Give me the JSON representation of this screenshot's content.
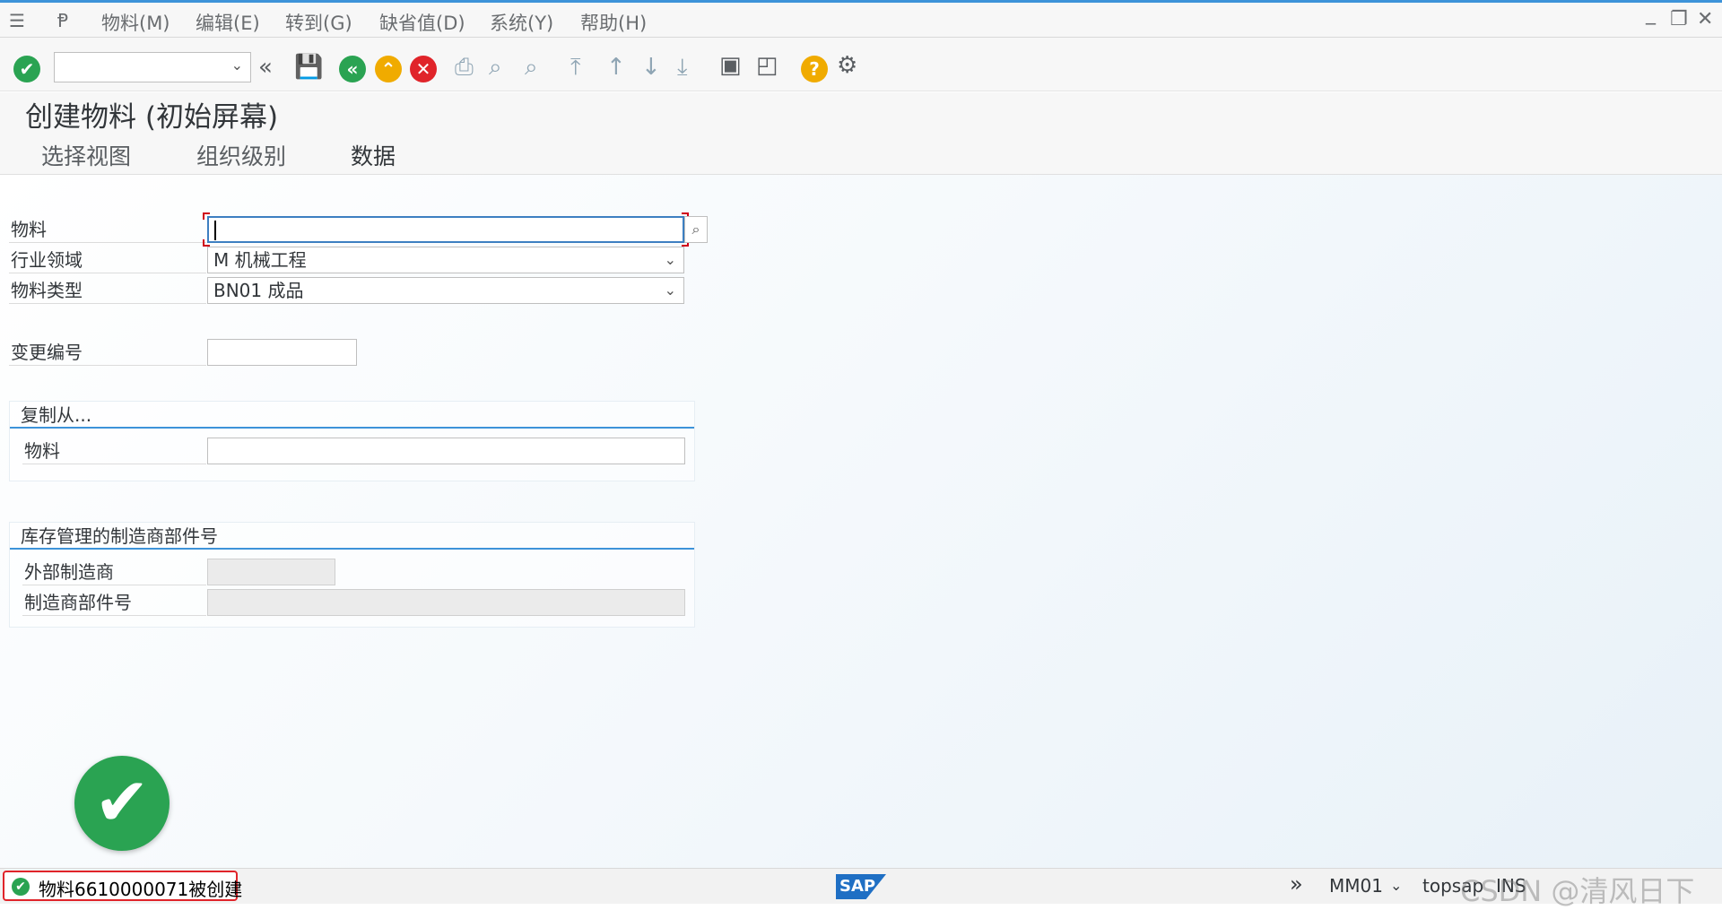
{
  "menu": {
    "items": [
      "物料(M)",
      "编辑(E)",
      "转到(G)",
      "缺省值(D)",
      "系统(Y)",
      "帮助(H)"
    ]
  },
  "window": {
    "minimize": "_",
    "restore": "❐",
    "close": "✕"
  },
  "page": {
    "title": "创建物料 (初始屏幕)",
    "app_buttons": [
      "选择视图",
      "组织级别",
      "数据"
    ]
  },
  "form": {
    "material_label": "物料",
    "material_value": "",
    "industry_label": "行业领域",
    "industry_value": "M 机械工程",
    "type_label": "物料类型",
    "type_value": "BN01 成品",
    "change_label": "变更编号",
    "change_value": ""
  },
  "copy_group": {
    "title": "复制从...",
    "material_label": "物料",
    "material_value": ""
  },
  "mpn_group": {
    "title": "库存管理的制造商部件号",
    "ext_mfr_label": "外部制造商",
    "ext_mfr_value": "",
    "mpn_label": "制造商部件号",
    "mpn_value": ""
  },
  "status": {
    "message": "物料6610000071被创建",
    "sap_logo": "SAP",
    "transaction": "MM01",
    "server": "topsap",
    "mode": "INS",
    "watermark": "CSDN @清风日下"
  },
  "colors": {
    "accent": "#3d93d9",
    "success": "#2aa352",
    "error": "#e0242a",
    "nav_green": "#2aa352",
    "nav_orange": "#f0ab00"
  }
}
